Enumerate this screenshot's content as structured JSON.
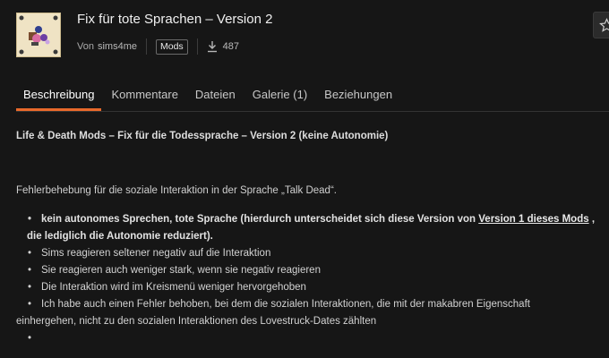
{
  "header": {
    "title": "Fix für tote Sprachen – Version 2",
    "by_label": "Von",
    "author": "sims4me",
    "category_badge": "Mods",
    "download_count": "487",
    "thumbnail_icon": "mod-thumbnail",
    "favorite_icon": "star-icon"
  },
  "tabs": [
    {
      "label": "Beschreibung",
      "active": true
    },
    {
      "label": "Kommentare"
    },
    {
      "label": "Dateien"
    },
    {
      "label": "Galerie (1)"
    },
    {
      "label": "Beziehungen"
    }
  ],
  "content": {
    "summary": "Life & Death Mods – Fix für die Todessprache – Version 2 (keine Autonomie)",
    "intro": "Fehlerbehebung für die soziale Interaktion in der Sprache „Talk Dead“.",
    "bullet1_part1": "kein autonomes Sprechen, tote Sprache (hierdurch unterscheidet sich diese Version von",
    "bullet1_link": "Version 1 dieses Mods",
    "bullet1_part2": ",",
    "bullet1_part3": "die lediglich die Autonomie reduziert).",
    "bullet2": "Sims reagieren seltener negativ auf die Interaktion",
    "bullet3": "Sie reagieren auch weniger stark, wenn sie negativ reagieren",
    "bullet4": "Die Interaktion wird im Kreismenü weniger hervorgehoben",
    "bullet5_line1": "Ich habe auch einen Fehler behoben, bei dem die sozialen Interaktionen, die mit der makabren Eigenschaft",
    "bullet5_line2": "einhergehen, nicht zu den sozialen Interaktionen des Lovestruck-Dates zählten",
    "bullet6": ""
  },
  "colors": {
    "background": "#161616",
    "accent": "#e8692b"
  }
}
